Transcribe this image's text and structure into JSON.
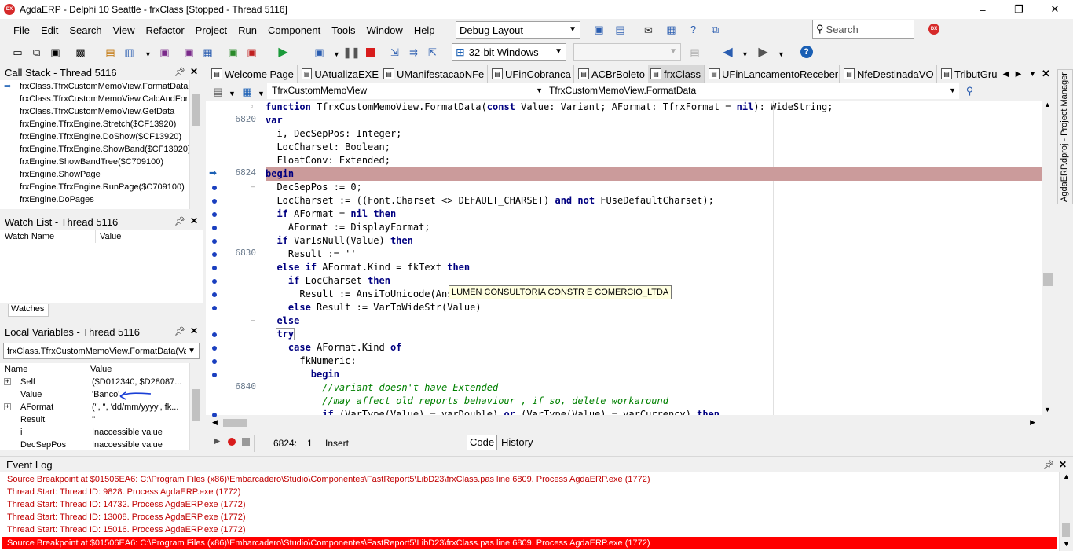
{
  "window": {
    "title": "AgdaERP - Delphi 10 Seattle - frxClass [Stopped - Thread 5116]",
    "logo_text": "DX",
    "controls": [
      "–",
      "❐",
      "✕"
    ]
  },
  "menu": [
    "File",
    "Edit",
    "Search",
    "View",
    "Refactor",
    "Project",
    "Run",
    "Component",
    "Tools",
    "Window",
    "Help"
  ],
  "toolbar": {
    "layout_combo": "Debug Layout",
    "platform_combo": "32-bit Windows",
    "config_combo": "",
    "search_placeholder": "Search"
  },
  "call_stack": {
    "title": "Call Stack - Thread 5116",
    "items": [
      "frxClass.TfrxCustomMemoView.FormatData",
      "frxClass.TfrxCustomMemoView.CalcAndForm",
      "frxClass.TfrxCustomMemoView.GetData",
      "frxEngine.TfrxEngine.Stretch($CF13920)",
      "frxEngine.TfrxEngine.DoShow($CF13920)",
      "frxEngine.TfrxEngine.ShowBand($CF13920)",
      "frxEngine.ShowBandTree($C709100)",
      "frxEngine.ShowPage",
      "frxEngine.TfrxEngine.RunPage($C709100)",
      "frxEngine.DoPages"
    ]
  },
  "watch_list": {
    "title": "Watch List - Thread 5116",
    "col_name": "Watch Name",
    "col_value": "Value",
    "tab": "Watches"
  },
  "locals": {
    "title": "Local Variables - Thread 5116",
    "frame": "frxClass.TfrxCustomMemoView.FormatData(Va",
    "col_name": "Name",
    "col_value": "Value",
    "rows": [
      {
        "expander": "+",
        "name": "Self",
        "value": "($D012340, $D28087..."
      },
      {
        "expander": "",
        "name": "Value",
        "value": "'Banco'"
      },
      {
        "expander": "+",
        "name": "AFormat",
        "value": "(\", \", 'dd/mm/yyyy', fk..."
      },
      {
        "expander": "",
        "name": "Result",
        "value": "''"
      },
      {
        "expander": "",
        "name": "i",
        "value": "Inaccessible value"
      },
      {
        "expander": "",
        "name": "DecSepPos",
        "value": "Inaccessible value"
      }
    ]
  },
  "editor": {
    "tabs": [
      "Welcome Page",
      "UAtualizaEXE",
      "UManifestacaoNFe",
      "UFinCobranca",
      "ACBrBoleto",
      "frxClass",
      "UFinLancamentoReceber",
      "NfeDestinadaVO",
      "TributGru"
    ],
    "active_tab": "frxClass",
    "class_combo": "TfrxCustomMemoView",
    "method_combo": "TfrxCustomMemoView.FormatData",
    "line_numbers": [
      "6820",
      "6824",
      "6830",
      "6840"
    ],
    "tooltip": "LUMEN CONSULTORIA CONSTR E COMERCIO_LTDA"
  },
  "status": {
    "position": "6824:",
    "column": "1",
    "mode": "Insert",
    "code_tab": "Code",
    "history_tab": "History"
  },
  "project_manager": {
    "label": "AgdaERP.dproj - Project Manager"
  },
  "event_log": {
    "title": "Event Log",
    "lines": [
      "Source Breakpoint at $01506EA6: C:\\Program Files (x86)\\Embarcadero\\Studio\\Componentes\\FastReport5\\LibD23\\frxClass.pas line 6809. Process AgdaERP.exe (1772)",
      "Thread Start: Thread ID: 9828. Process AgdaERP.exe (1772)",
      "Thread Start: Thread ID: 14732. Process AgdaERP.exe (1772)",
      "Thread Start: Thread ID: 13008. Process AgdaERP.exe (1772)",
      "Thread Start: Thread ID: 15016. Process AgdaERP.exe (1772)",
      "Source Breakpoint at $01506EA6: C:\\Program Files (x86)\\Embarcadero\\Studio\\Componentes\\FastReport5\\LibD23\\frxClass.pas line 6809. Process AgdaERP.exe (1772)"
    ]
  },
  "colors": {
    "breakpoint_line": "#cb9b9b",
    "event_highlight": "#ff0000",
    "keyword": "#000080",
    "comment": "#008000"
  }
}
